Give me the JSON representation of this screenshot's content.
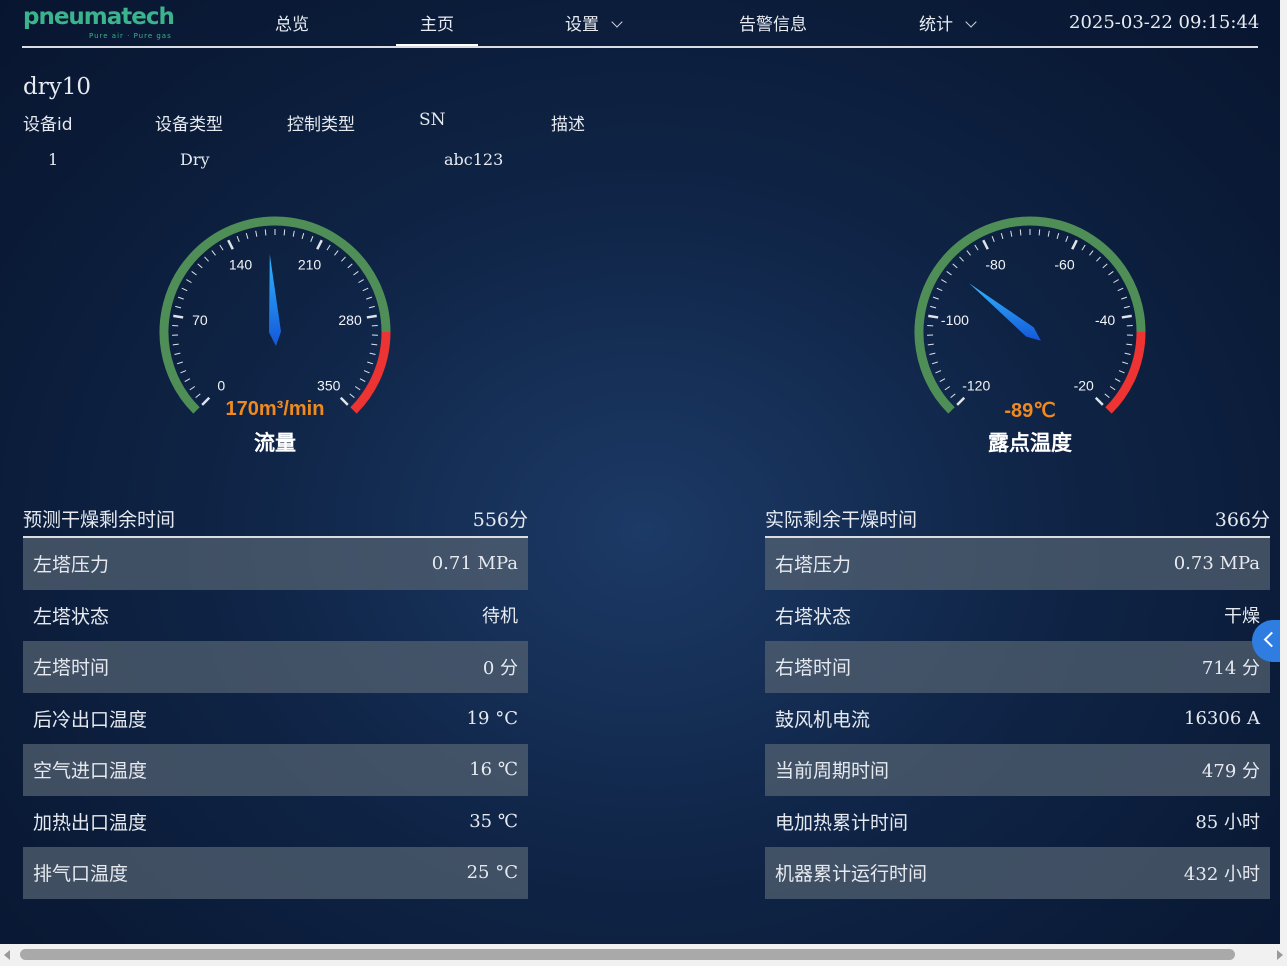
{
  "brand": {
    "name": "pneumatech",
    "tagline": "Pure air · Pure gas"
  },
  "nav": {
    "items": [
      {
        "label": "总览"
      },
      {
        "label": "主页"
      },
      {
        "label": "设置"
      },
      {
        "label": "告警信息"
      },
      {
        "label": "统计"
      }
    ],
    "active": "主页",
    "datetime": "2025-03-22 09:15:44"
  },
  "device": {
    "name": "dry10",
    "headers": {
      "id": "设备id",
      "type": "设备类型",
      "control": "控制类型",
      "sn": "SN",
      "desc": "描述"
    },
    "values": {
      "id": "1",
      "type": "Dry",
      "control": "",
      "sn": "abc123",
      "desc": ""
    }
  },
  "gauges": [
    {
      "name": "流量",
      "value_text": "170m³/min",
      "value": 170,
      "min": 0,
      "max": 350,
      "ticks": [
        "0",
        "70",
        "140",
        "210",
        "280",
        "350"
      ],
      "colors": {
        "normal": "#4f8f57",
        "alarm": "#ee3333"
      }
    },
    {
      "name": "露点温度",
      "value_text": "-89℃",
      "value": -89,
      "min": -120,
      "max": -20,
      "ticks": [
        "-120",
        "-100",
        "-80",
        "-60",
        "-40",
        "-20"
      ],
      "colors": {
        "normal": "#4f8f57",
        "alarm": "#ee3333"
      }
    }
  ],
  "left_panel": {
    "title": "预测干燥剩余时间",
    "title_value": "556分",
    "rows": [
      {
        "label": "左塔压力",
        "value": "0.71 MPa"
      },
      {
        "label": "左塔状态",
        "value": "待机"
      },
      {
        "label": "左塔时间",
        "value": "0 分"
      },
      {
        "label": "后冷出口温度",
        "value": "19 °C"
      },
      {
        "label": "空气进口温度",
        "value": "16 ℃"
      },
      {
        "label": "加热出口温度",
        "value": "35 ℃"
      },
      {
        "label": "排气口温度",
        "value": "25 °C"
      }
    ]
  },
  "right_panel": {
    "title": "实际剩余干燥时间",
    "title_value": "366分",
    "rows": [
      {
        "label": "右塔压力",
        "value": "0.73 MPa"
      },
      {
        "label": "右塔状态",
        "value": "干燥"
      },
      {
        "label": "右塔时间",
        "value": "714 分"
      },
      {
        "label": "鼓风机电流",
        "value": "16306 A"
      },
      {
        "label": "当前周期时间",
        "value": "479 分"
      },
      {
        "label": "电加热累计时间",
        "value": "85 小时"
      },
      {
        "label": "机器累计运行时间",
        "value": "432 小时"
      }
    ]
  }
}
